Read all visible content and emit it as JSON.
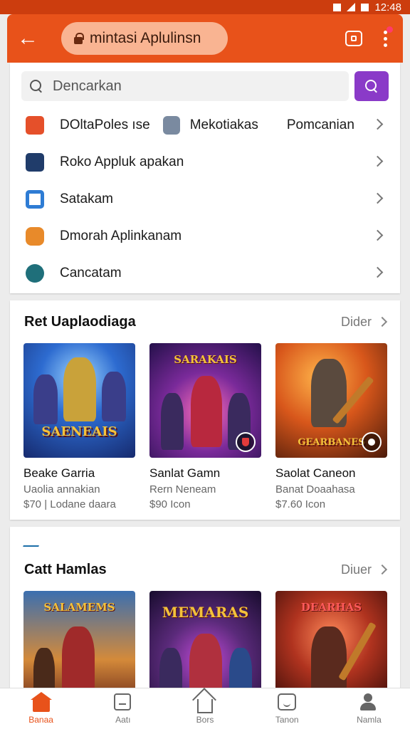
{
  "status_bar": {
    "time": "12:48"
  },
  "app_bar": {
    "url_text": "mintasi Aplulinsn"
  },
  "search": {
    "placeholder": "Dencarkan"
  },
  "categories": {
    "items": [
      {
        "label": "DOltaPoles ıse",
        "extra_label": "Mekotiakas",
        "tail_label": "Pomcanian"
      },
      {
        "label": "Roko Appluk apakan"
      },
      {
        "label": "Satakam"
      },
      {
        "label": "Dmorah Aplinkanam"
      },
      {
        "label": "Cancatam"
      }
    ]
  },
  "section1": {
    "title": "Ret Uaplaodiaga",
    "more_label": "Dider",
    "games": [
      {
        "art_title": "SAENEAIS",
        "art_top": "",
        "name": "Beake Garria",
        "subtitle": "Uaolia annakian",
        "price": "$70 | Lodane daara"
      },
      {
        "art_title": "",
        "art_top": "SARAKAIS",
        "name": "Sanlat Gamn",
        "subtitle": "Rern Neneam",
        "price": "$90 Icon"
      },
      {
        "art_title": "GEARBANES",
        "art_top": "",
        "name": "Saolat Caneon",
        "subtitle": "Banat Doaahasa",
        "price": "$7.60 Icon"
      }
    ]
  },
  "section2": {
    "title": "Catt Hamlas",
    "more_label": "Diuer",
    "games": [
      {
        "art_top": "SALAMEMS"
      },
      {
        "art_top": "MEMARAS"
      },
      {
        "art_top": "DEARHAS"
      }
    ]
  },
  "bottom_nav": {
    "items": [
      {
        "label": "Banaa",
        "icon": "home-filled-icon"
      },
      {
        "label": "Aatı",
        "icon": "apps-box-icon"
      },
      {
        "label": "Bors",
        "icon": "home-outline-icon"
      },
      {
        "label": "Tanon",
        "icon": "smile-box-icon"
      },
      {
        "label": "Namla",
        "icon": "user-icon"
      }
    ]
  },
  "colors": {
    "accent": "#e8521a",
    "search_button": "#8a3ac8",
    "status_bar": "#cc3d0e"
  }
}
